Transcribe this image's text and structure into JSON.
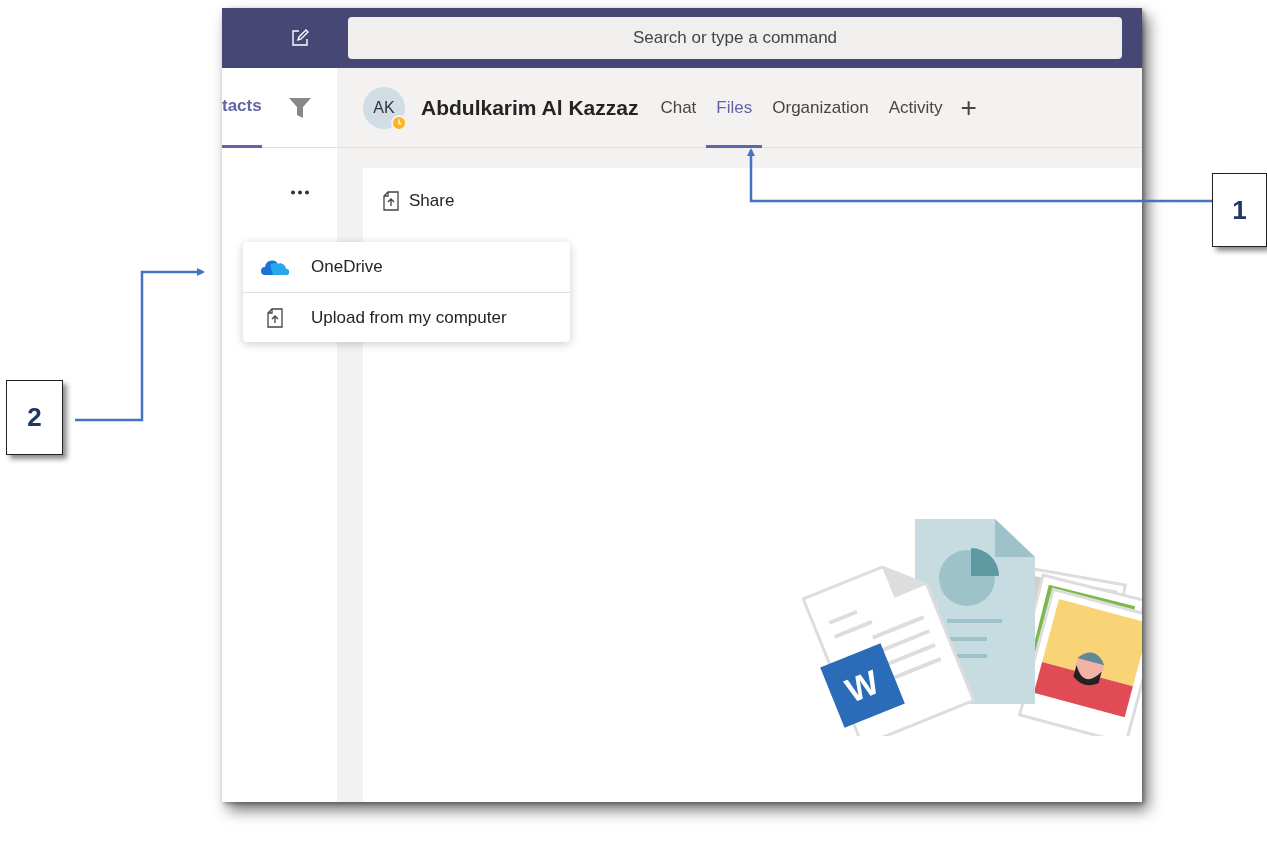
{
  "search": {
    "placeholder": "Search or type a command"
  },
  "sidebar": {
    "tab": {
      "label": "tacts",
      "selected": true
    }
  },
  "contact": {
    "initials": "AK",
    "away": true,
    "name": "Abdulkarim Al Kazzaz"
  },
  "tabs": [
    {
      "label": "Chat",
      "selected": false
    },
    {
      "label": "Files",
      "selected": true
    },
    {
      "label": "Organization",
      "selected": false
    },
    {
      "label": "Activity",
      "selected": false
    }
  ],
  "add_tab": "+",
  "toolbar": {
    "share": "Share"
  },
  "menu": [
    {
      "kind": "cloud",
      "label": "OneDrive"
    },
    {
      "kind": "upload",
      "label": "Upload from my computer"
    }
  ],
  "illustration": {
    "logo_letter": "W"
  },
  "callouts": [
    {
      "number": "1"
    },
    {
      "number": "2"
    }
  ]
}
